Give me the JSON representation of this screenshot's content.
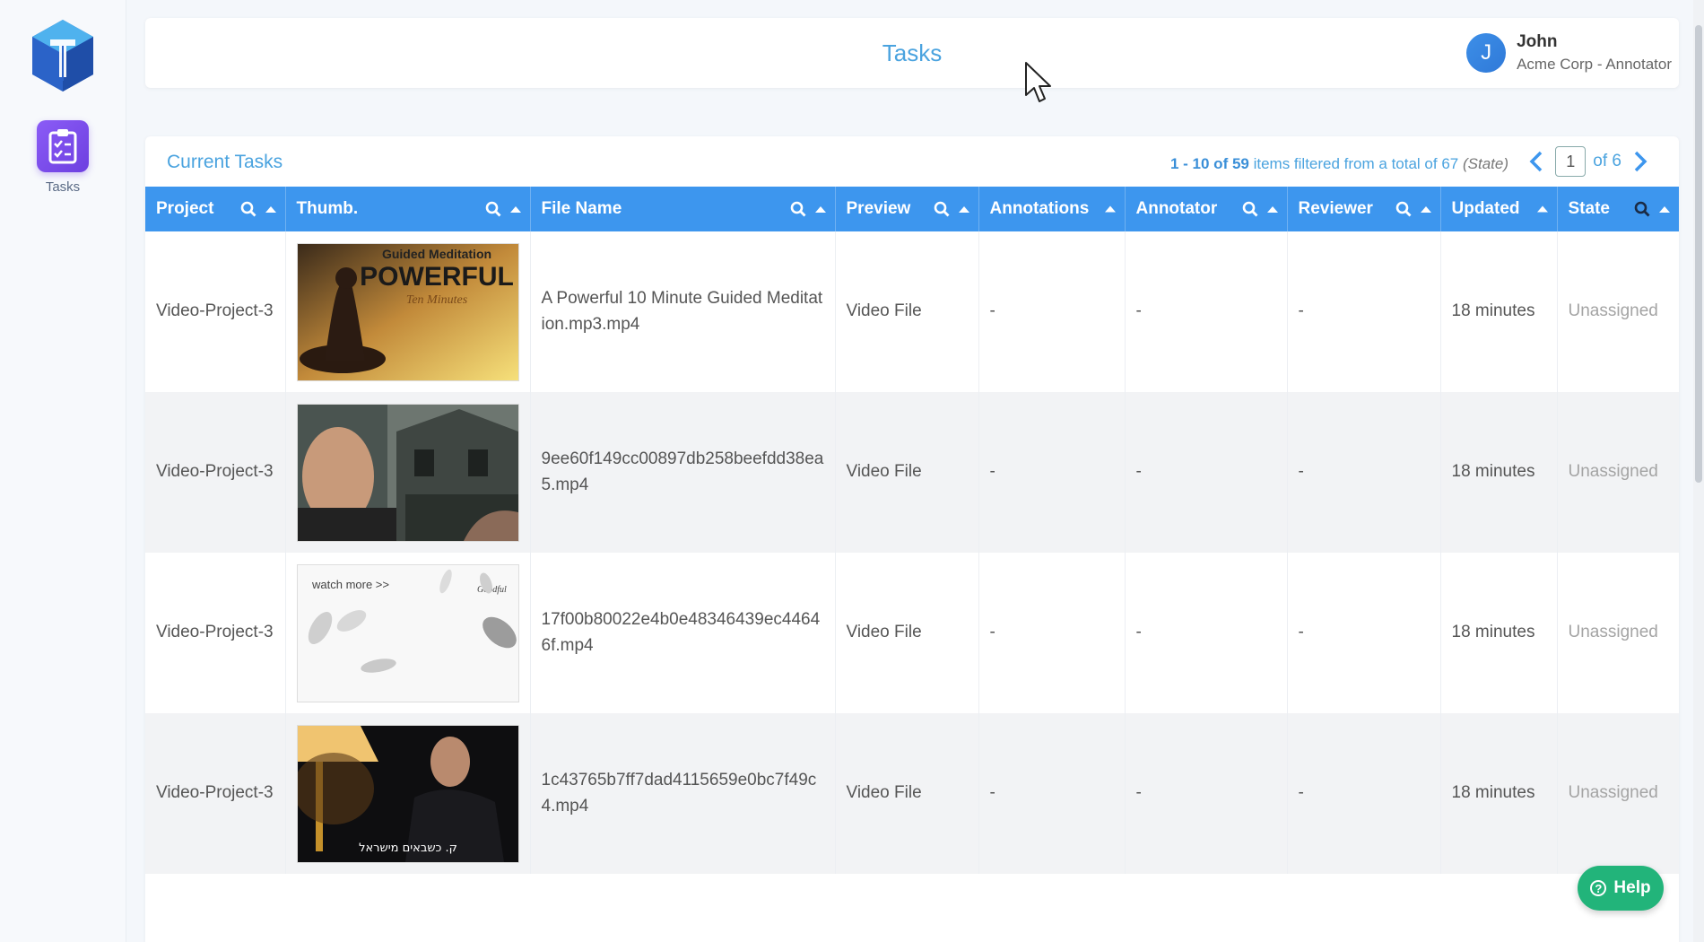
{
  "sidebar": {
    "logo_icon": "hexagon-logo",
    "items": [
      {
        "label": "Tasks",
        "icon": "clipboard-check-icon"
      }
    ]
  },
  "header": {
    "title": "Tasks",
    "user": {
      "initial": "J",
      "name": "John",
      "role": "Acme Corp - Annotator"
    }
  },
  "tasks_card": {
    "title": "Current Tasks",
    "summary": {
      "range": "1 - 10 of 59",
      "text": " items filtered from a total of 67 ",
      "filter": "(State)"
    },
    "pager": {
      "page": "1",
      "of": "of 6"
    }
  },
  "table": {
    "columns": [
      {
        "label": "Project",
        "search": true,
        "sort": true
      },
      {
        "label": "Thumb.",
        "search": true,
        "sort": true
      },
      {
        "label": "File Name",
        "search": true,
        "sort": true
      },
      {
        "label": "Preview",
        "search": true,
        "sort": true
      },
      {
        "label": "Annotations",
        "search": false,
        "sort": true
      },
      {
        "label": "Annotator",
        "search": true,
        "sort": true
      },
      {
        "label": "Reviewer",
        "search": true,
        "sort": true
      },
      {
        "label": "Updated",
        "search": false,
        "sort": true
      },
      {
        "label": "State",
        "search": true,
        "sort": true
      }
    ],
    "rows": [
      {
        "project": "Video-Project-3",
        "thumb_text": [
          "Guided Meditation",
          "POWERFUL",
          "Ten Minutes"
        ],
        "file": "A Powerful 10 Minute Guided Meditation.mp3.mp4",
        "preview": "Video File",
        "annotations": "-",
        "annotator": "-",
        "reviewer": "-",
        "updated": "18 minutes",
        "state": "Unassigned"
      },
      {
        "project": "Video-Project-3",
        "thumb_text": [],
        "file": "9ee60f149cc00897db258beefdd38ea5.mp4",
        "preview": "Video File",
        "annotations": "-",
        "annotator": "-",
        "reviewer": "-",
        "updated": "18 minutes",
        "state": "Unassigned"
      },
      {
        "project": "Video-Project-3",
        "thumb_text": [
          "watch more >>",
          "Goodful"
        ],
        "file": "17f00b80022e4b0e48346439ec44646f.mp4",
        "preview": "Video File",
        "annotations": "-",
        "annotator": "-",
        "reviewer": "-",
        "updated": "18 minutes",
        "state": "Unassigned"
      },
      {
        "project": "Video-Project-3",
        "thumb_text": [
          "ק. כשבאים מישראל"
        ],
        "file": "1c43765b7ff7dad4115659e0bc7f49c4.mp4",
        "preview": "Video File",
        "annotations": "-",
        "annotator": "-",
        "reviewer": "-",
        "updated": "18 minutes",
        "state": "Unassigned"
      }
    ]
  },
  "help": {
    "label": "Help",
    "icon": "question-circle-icon"
  },
  "colors": {
    "accent": "#3d96ee",
    "title_blue": "#4aa3df",
    "nav_purple": "#7c4ae8",
    "help_green": "#22b47a"
  }
}
